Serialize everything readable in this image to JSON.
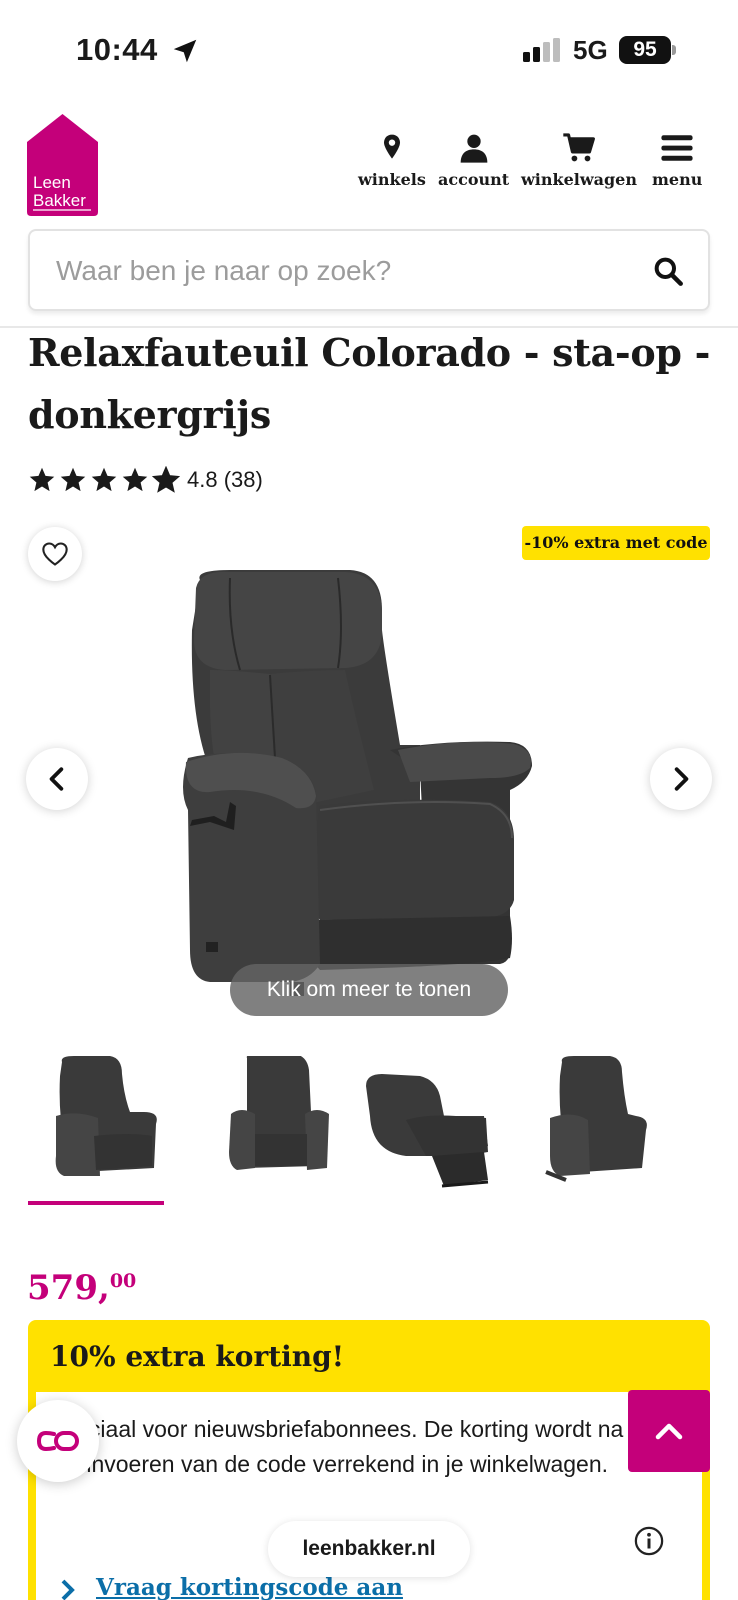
{
  "status_bar": {
    "time": "10:44",
    "network": "5G",
    "battery": "95"
  },
  "brand": {
    "logo_line1": "Leen",
    "logo_line2": "Bakker",
    "color": "#c4007a"
  },
  "nav": [
    {
      "label": "winkels",
      "icon": "map-pin-icon"
    },
    {
      "label": "account",
      "icon": "user-icon"
    },
    {
      "label": "winkelwagen",
      "icon": "cart-icon"
    },
    {
      "label": "menu",
      "icon": "hamburger-icon"
    }
  ],
  "search": {
    "placeholder": "Waar ben je naar op zoek?"
  },
  "product": {
    "title": "Relaxfauteuil Colorado - sta-op - donkergrijs",
    "rating_stars": 4.8,
    "rating_text": "4.8 (38)",
    "promo_badge": "-10% extra met code",
    "more_images_label": "Klik om meer te tonen",
    "thumbnail_count": 4,
    "selected_thumbnail": 1,
    "price_euros": "579,",
    "price_cents": "00"
  },
  "discount": {
    "heading": "10% extra korting!",
    "text": "Speciaal voor nieuwsbriefabonnees. De korting wordt na het invoeren van de code verrekend in je winkelwagen.",
    "link": "Vraag kortingscode aan",
    "background": "#ffe100"
  },
  "browser": {
    "url": "leenbakker.nl"
  }
}
